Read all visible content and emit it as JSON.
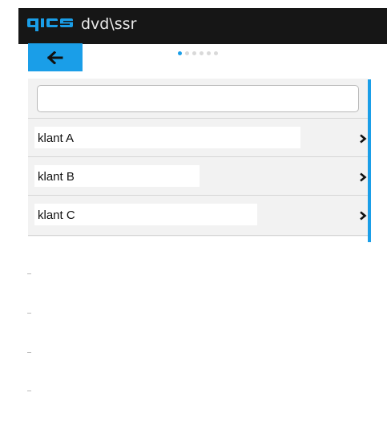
{
  "header": {
    "brand": "qics",
    "title": "dvd\\ssr",
    "brand_color": "#1a9ee8",
    "background": "#161616"
  },
  "toolbar": {
    "back_icon": "arrow-left-icon"
  },
  "pager": {
    "page_count": 6,
    "active_page": 1
  },
  "search": {
    "value": "",
    "placeholder": ""
  },
  "list": {
    "items": [
      {
        "label": "klant A",
        "icon": "chevron-right-icon"
      },
      {
        "label": "klant B",
        "icon": "chevron-right-icon"
      },
      {
        "label": "klant C",
        "icon": "chevron-right-icon"
      }
    ]
  },
  "colors": {
    "accent": "#1a9ee8",
    "panel": "#f2f2f2",
    "divider": "#d6d6d6"
  }
}
